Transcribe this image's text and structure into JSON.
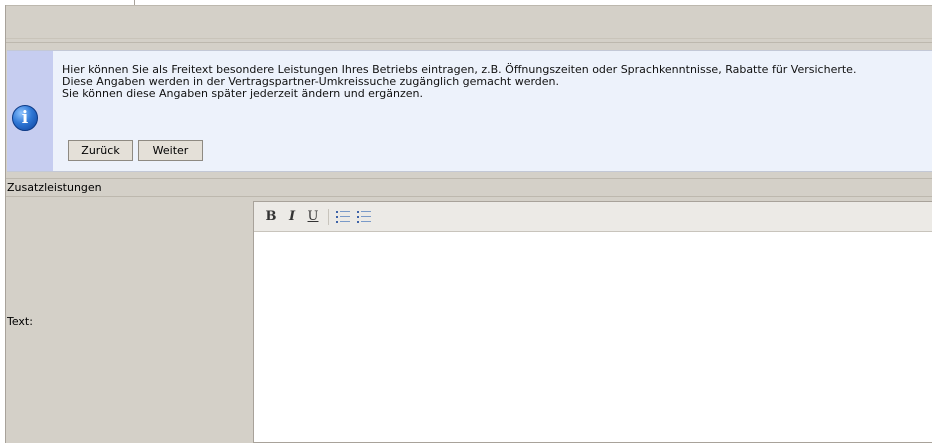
{
  "info": {
    "line1": "Hier können Sie als Freitext besondere Leistungen Ihres Betriebs eintragen, z.B. Öffnungszeiten oder Sprachkenntnisse, Rabatte für Versicherte.",
    "line2": "Diese Angaben werden in der Vertragspartner-Umkreissuche zugänglich gemacht werden.",
    "line3": "Sie können diese Angaben später jederzeit ändern und ergänzen.",
    "icon": "info-icon",
    "icon_glyph": "i"
  },
  "buttons": {
    "back_label": "Zurück",
    "next_label": "Weiter"
  },
  "section": {
    "title": "Zusatzleistungen"
  },
  "form": {
    "text_label": "Text:",
    "text_value": ""
  },
  "editor_toolbar": {
    "bold": "B",
    "italic": "I",
    "underline": "U",
    "ordered_list_icon": "ordered-list-icon",
    "unordered_list_icon": "unordered-list-icon"
  },
  "colors": {
    "panel_bg": "#d4d0c8",
    "info_bg": "#edf2fb",
    "info_icon_bg": "#c6cdf0",
    "info_icon": "#2f78d6"
  }
}
